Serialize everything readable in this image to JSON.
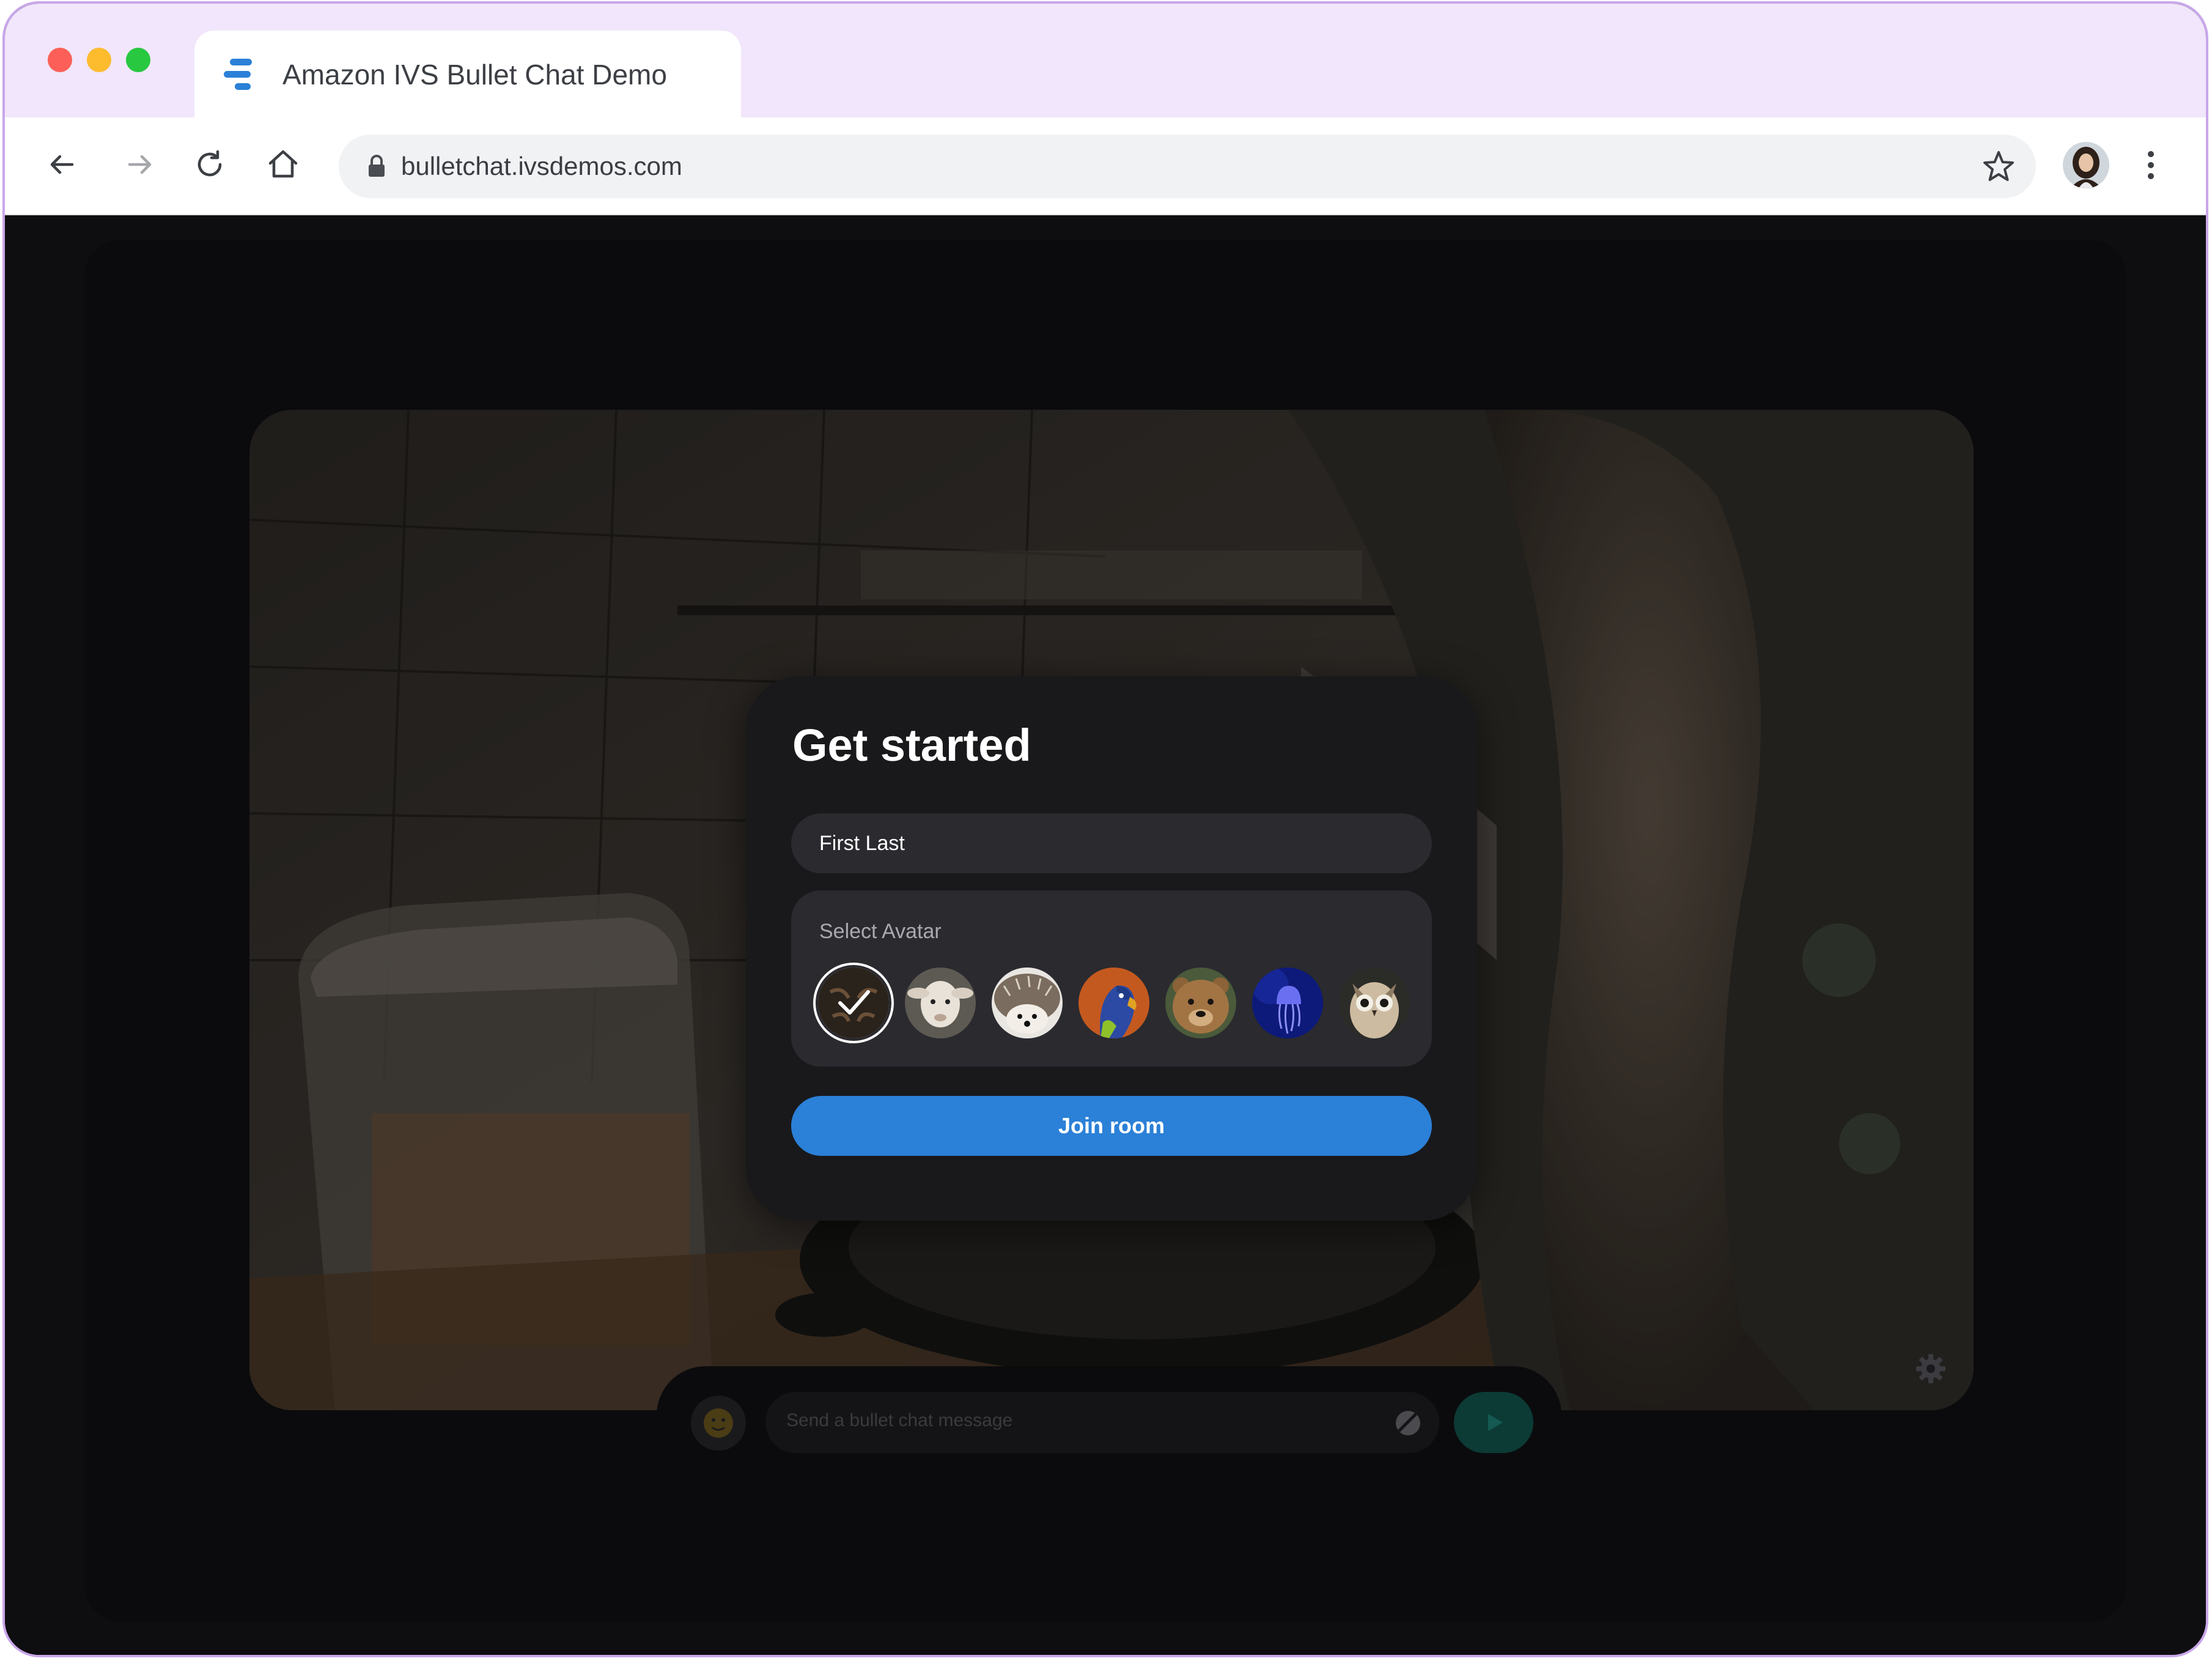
{
  "browser": {
    "tab_title": "Amazon IVS Bullet Chat Demo",
    "url": "bulletchat.ivsdemos.com",
    "nav_icons": [
      "back-icon",
      "forward-icon",
      "reload-icon",
      "home-icon"
    ],
    "lock_icon": "lock-icon",
    "bookmark_icon": "star-icon",
    "menu_icon": "kebab-icon"
  },
  "modal": {
    "title": "Get started",
    "name_value": "First Last",
    "avatar_label": "Select Avatar",
    "avatars": [
      "tiger",
      "lamb",
      "hedgehog",
      "parrot",
      "bear",
      "jellyfish",
      "owl"
    ],
    "selected_avatar": "tiger",
    "join_label": "Join room"
  },
  "chat": {
    "placeholder": "Send a bullet chat message"
  },
  "colors": {
    "accent": "#2b80d7",
    "modal_bg": "#19191c",
    "panel_bg": "#2a2a2f",
    "send": "#0c3a35"
  }
}
